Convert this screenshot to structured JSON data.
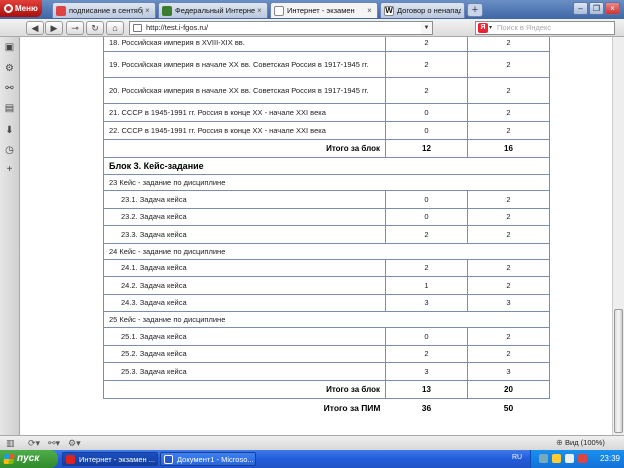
{
  "browser": {
    "menu_label": "Меню",
    "tabs": [
      {
        "label": "подписание в сентябре..."
      },
      {
        "label": "Федеральный Интерне..."
      },
      {
        "label": "Интернет - экзамен"
      },
      {
        "label": "Договор о ненападени..."
      }
    ],
    "new_tab_label": "+",
    "address": "http://test.i-fgos.ru/",
    "search_placeholder": "Поиск в Яндекс"
  },
  "table": {
    "rows": [
      {
        "kind": "item",
        "text": "18. Российская империя в XVIII-XIX вв.",
        "a": "2",
        "b": "2"
      },
      {
        "kind": "item",
        "text": "19. Российская империя в начале XX вв. Советская Россия в 1917-1945 гг.",
        "a": "2",
        "b": "2"
      },
      {
        "kind": "item",
        "text": "20. Российская империя в начале XX вв. Советская Россия в 1917-1945 гг.",
        "a": "2",
        "b": "2"
      },
      {
        "kind": "item",
        "text": "21. СССР в 1945-1991 гг. Россия в конце XX - начале XXI века",
        "a": "0",
        "b": "2"
      },
      {
        "kind": "item",
        "text": "22. СССР в 1945-1991 гг. Россия в конце XX - начале XXI века",
        "a": "0",
        "b": "2"
      },
      {
        "kind": "total",
        "text": "Итого за блок",
        "a": "12",
        "b": "16"
      },
      {
        "kind": "block",
        "text": "Блок 3. Кейс-задание"
      },
      {
        "kind": "group",
        "text": "23 Кейс - задание по дисциплине"
      },
      {
        "kind": "sub",
        "text": "23.1. Задача кейса",
        "a": "0",
        "b": "2"
      },
      {
        "kind": "sub",
        "text": "23.2. Задача кейса",
        "a": "0",
        "b": "2"
      },
      {
        "kind": "sub",
        "text": "23.3. Задача кейса",
        "a": "2",
        "b": "2"
      },
      {
        "kind": "group",
        "text": "24 Кейс - задание по дисциплине"
      },
      {
        "kind": "sub",
        "text": "24.1. Задача кейса",
        "a": "2",
        "b": "2"
      },
      {
        "kind": "sub",
        "text": "24.2. Задача кейса",
        "a": "1",
        "b": "2"
      },
      {
        "kind": "sub",
        "text": "24.3. Задача кейса",
        "a": "3",
        "b": "3"
      },
      {
        "kind": "group",
        "text": "25 Кейс - задание по дисциплине"
      },
      {
        "kind": "sub",
        "text": "25.1. Задача кейса",
        "a": "0",
        "b": "2"
      },
      {
        "kind": "sub",
        "text": "25.2. Задача кейса",
        "a": "2",
        "b": "2"
      },
      {
        "kind": "sub",
        "text": "25.3. Задача кейса",
        "a": "3",
        "b": "3"
      },
      {
        "kind": "total",
        "text": "Итого за блок",
        "a": "13",
        "b": "20"
      },
      {
        "kind": "grand",
        "text": "Итого за ПИМ",
        "a": "36",
        "b": "50"
      }
    ]
  },
  "statusbar": {
    "zoom": "Вид (100%)"
  },
  "taskbar": {
    "start_label": "пуск",
    "tasks": [
      {
        "label": "Интернет - экзамен ..."
      },
      {
        "label": "Документ1 - Microso..."
      }
    ],
    "lang": "RU",
    "clock": "23:39"
  },
  "colors": {
    "tab_bar": "#3f66a6",
    "table_border": "#7a8fb0",
    "taskbar": "#245edb",
    "start_button": "#2f8a2a"
  }
}
